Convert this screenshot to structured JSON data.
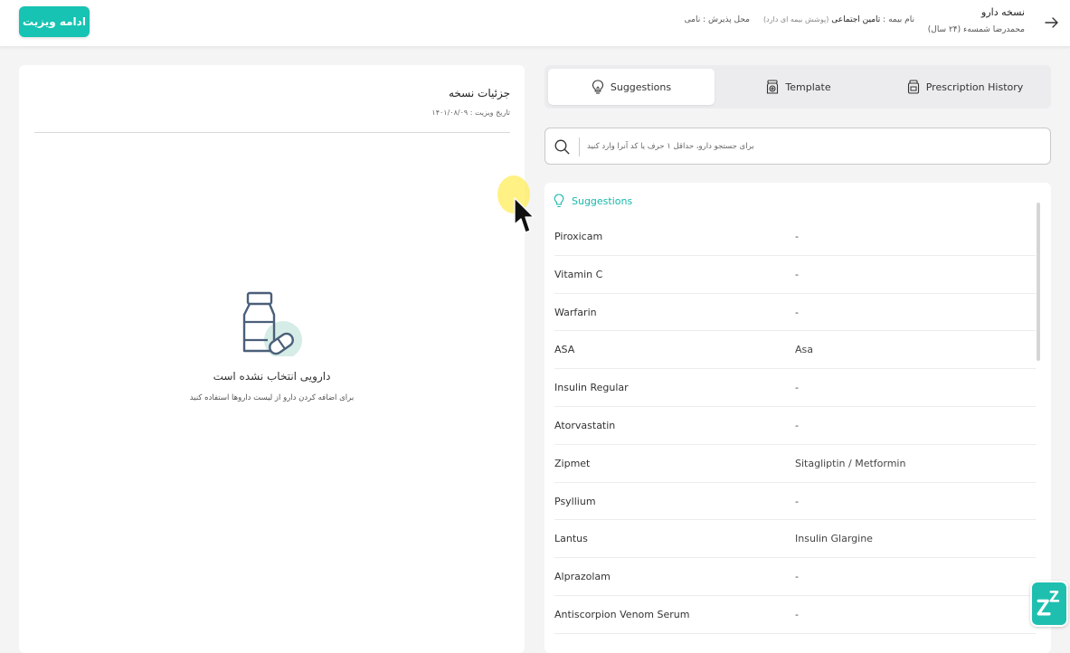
{
  "header": {
    "continue_label": "ادامه ویزیت",
    "title": "نسخه دارو",
    "patient": "محمدرضا شمسه‌ء (۲۴ سال)",
    "insurance_label": "نام بیمه :",
    "insurance_value": "تامین اجتماعی",
    "insurance_note": "(پوشش بیمه ای دارد)",
    "center_label": "محل پذیرش :",
    "center_value": "نامی"
  },
  "details": {
    "title": "جزئیات نسخه",
    "visit_date": "تاریخ ویزیت : ۱۴۰۱/۰۸/۰۹",
    "empty_title": "دارویی انتخاب نشده است",
    "empty_subtitle": "برای اضافه کردن دارو از لیست داروها استفاده کنید"
  },
  "tabs": [
    {
      "label": "Suggestions",
      "icon": "lightbulb-icon",
      "active": true
    },
    {
      "label": "Template",
      "icon": "medication-icon",
      "active": false
    },
    {
      "label": "Prescription History",
      "icon": "pill-bottle-icon",
      "active": false
    }
  ],
  "search": {
    "placeholder": "برای جستجو دارو، حداقل ۱ حرف یا کد آنرا وارد کنید"
  },
  "suggestions": {
    "title": "Suggestions",
    "items": [
      {
        "name": "Piroxicam",
        "generic": "-"
      },
      {
        "name": "Vitamin C",
        "generic": "-"
      },
      {
        "name": "Warfarin",
        "generic": "-"
      },
      {
        "name": "ASA",
        "generic": "Asa"
      },
      {
        "name": "Insulin Regular",
        "generic": "-"
      },
      {
        "name": "Atorvastatin",
        "generic": "-"
      },
      {
        "name": "Zipmet",
        "generic": "Sitagliptin / Metformin"
      },
      {
        "name": "Psyllium",
        "generic": "-"
      },
      {
        "name": "Lantus",
        "generic": "Insulin Glargine"
      },
      {
        "name": "Alprazolam",
        "generic": "-"
      },
      {
        "name": "Antiscorpion Venom Serum",
        "generic": "-"
      }
    ]
  },
  "colors": {
    "accent": "#17c3b2",
    "background": "#f4f4f5"
  }
}
